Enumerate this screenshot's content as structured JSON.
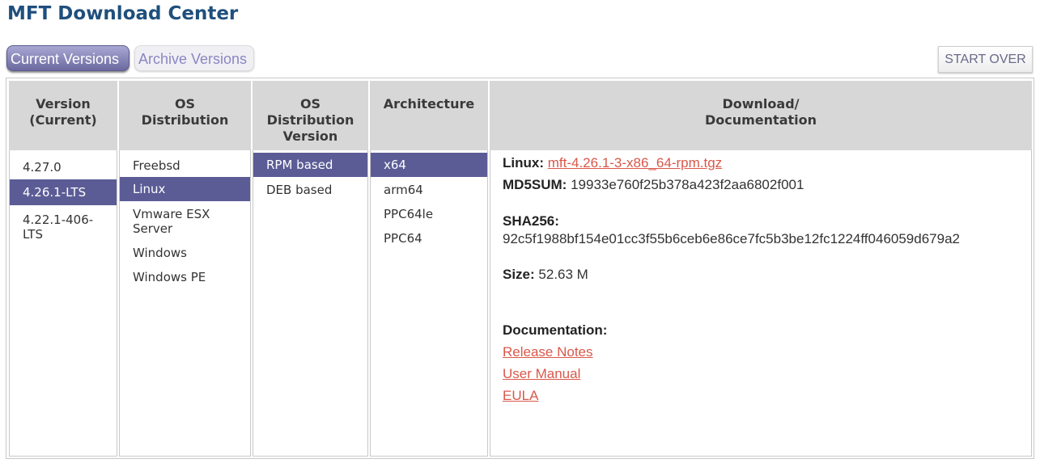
{
  "page_title": "MFT Download Center",
  "tabs": {
    "current": "Current Versions",
    "archive": "Archive Versions"
  },
  "start_over": "START OVER",
  "columns": {
    "version": {
      "header_line1": "Version",
      "header_line2": "(Current)",
      "items": [
        "4.27.0",
        "4.26.1-LTS",
        "4.22.1-406-LTS"
      ],
      "selected": "4.26.1-LTS"
    },
    "os": {
      "header_line1": "OS",
      "header_line2": "Distribution",
      "items": [
        "Freebsd",
        "Linux",
        "Vmware ESX Server",
        "Windows",
        "Windows PE"
      ],
      "selected": "Linux"
    },
    "os_version": {
      "header_line1": "OS",
      "header_line2": "Distribution",
      "header_line3": "Version",
      "items": [
        "RPM based",
        "DEB based"
      ],
      "selected": "RPM based"
    },
    "arch": {
      "header_line1": "Architecture",
      "items": [
        "x64",
        "arm64",
        "PPC64le",
        "PPC64"
      ],
      "selected": "x64"
    },
    "download": {
      "header_line1": "Download/",
      "header_line2": "Documentation"
    }
  },
  "download": {
    "linux_label": "Linux:",
    "linux_file": "mft-4.26.1-3-x86_64-rpm.tgz",
    "md5_label": "MD5SUM:",
    "md5_value": "19933e760f25b378a423f2aa6802f001",
    "sha_label": "SHA256:",
    "sha_value": "92c5f1988bf154e01cc3f55b6ceb6e86ce7fc5b3be12fc1224ff046059d679a2",
    "size_label": "Size:",
    "size_value": "52.63 M",
    "doc_label": "Documentation:",
    "release_notes": "Release Notes",
    "user_manual": "User Manual",
    "eula": "EULA"
  },
  "colors": {
    "title": "#1f4f7d",
    "selected": "#5b5c96",
    "link": "#d9584a",
    "header_bg": "#d7d7d7"
  }
}
